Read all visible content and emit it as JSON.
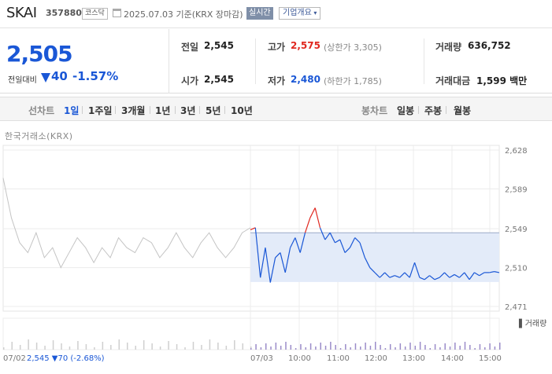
{
  "header": {
    "stock_name": "SKAI",
    "stock_code": "357880",
    "market": "코스닥",
    "date_text": "2025.07.03  기준(KRX 장마감)",
    "realtime_label": "실시간",
    "overview_label": "기업개요"
  },
  "price": {
    "current": "2,505",
    "change_label": "전일대비",
    "change": "40",
    "change_pct": "-1.57%"
  },
  "stats": {
    "prev_close_label": "전일",
    "prev_close": "2,545",
    "high_label": "고가",
    "high": "2,575",
    "upper_limit": "(상한가 3,305)",
    "volume_label": "거래량",
    "volume": "636,752",
    "open_label": "시가",
    "open": "2,545",
    "low_label": "저가",
    "low": "2,480",
    "lower_limit": "(하한가 1,785)",
    "value_label": "거래대금",
    "value": "1,599 백만"
  },
  "nav": {
    "line_label": "선차트",
    "periods": [
      "1일",
      "1주일",
      "3개월",
      "1년",
      "3년",
      "5년",
      "10년"
    ],
    "candle_label": "봉차트",
    "candles": [
      "일봉",
      "주봉",
      "월봉"
    ]
  },
  "chart_data": {
    "type": "line",
    "source": "한국거래소(KRX)",
    "y_ticks": [
      "2,628",
      "2,589",
      "2,549",
      "2,510",
      "2,471"
    ],
    "ylim": [
      2471,
      2628
    ],
    "x_ticks": [
      "10:00",
      "11:00",
      "12:00",
      "13:00",
      "14:00",
      "15:00"
    ],
    "reference_price": 2545,
    "volume_label": "거래량",
    "series": [
      {
        "name": "07/02",
        "values": [
          2600,
          2560,
          2535,
          2525,
          2545,
          2520,
          2530,
          2510,
          2525,
          2540,
          2530,
          2515,
          2530,
          2520,
          2540,
          2530,
          2525,
          2540,
          2535,
          2520,
          2530,
          2545,
          2530,
          2520,
          2535,
          2545,
          2530,
          2520,
          2530,
          2545,
          2550
        ]
      },
      {
        "name": "07/03",
        "values": [
          2548,
          2550,
          2500,
          2530,
          2495,
          2520,
          2525,
          2505,
          2530,
          2540,
          2525,
          2545,
          2560,
          2570,
          2550,
          2538,
          2545,
          2535,
          2538,
          2525,
          2530,
          2540,
          2535,
          2520,
          2510,
          2505,
          2500,
          2505,
          2500,
          2502,
          2500,
          2505,
          2500,
          2515,
          2500,
          2498,
          2502,
          2498,
          2500,
          2505,
          2500,
          2503,
          2500,
          2505,
          2498,
          2505,
          2502,
          2505,
          2505,
          2506,
          2505
        ]
      }
    ]
  },
  "footer": {
    "prev_date": "07/02",
    "prev_summary_price": "2,545",
    "prev_summary_change": "▼70",
    "prev_summary_pct": "(-2.68%)",
    "cur_date": "07/03",
    "colors": {
      "up": "#e0271f",
      "down": "#1a57d6",
      "prev": "#c4c4c4"
    }
  }
}
